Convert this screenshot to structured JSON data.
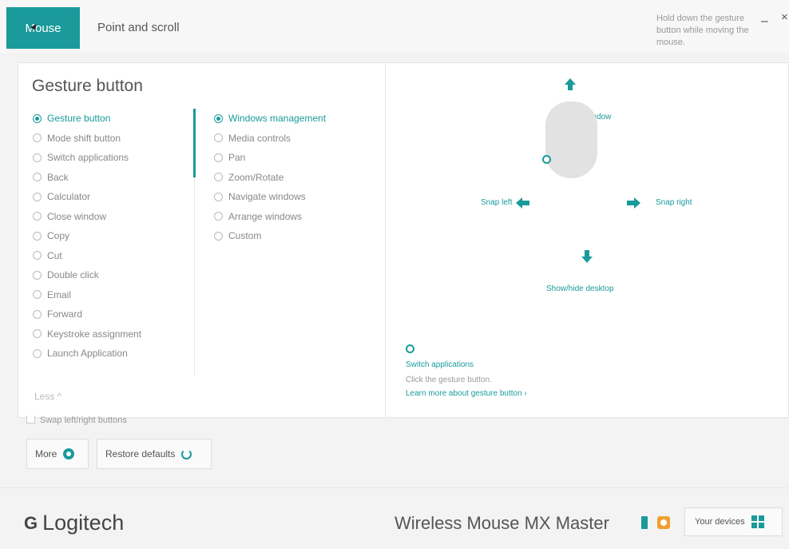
{
  "window": {
    "minimize": "–",
    "close": "×"
  },
  "tabs": {
    "mouse": "Mouse",
    "point_scroll": "Point and scroll"
  },
  "panel": {
    "title": "Gesture button",
    "buttons_list": [
      {
        "label": "Gesture button",
        "selected": true
      },
      {
        "label": "Mode shift button",
        "selected": false
      },
      {
        "label": "Switch applications",
        "selected": false
      },
      {
        "label": "Back",
        "selected": false
      },
      {
        "label": "Calculator",
        "selected": false
      },
      {
        "label": "Close window",
        "selected": false
      },
      {
        "label": "Copy",
        "selected": false
      },
      {
        "label": "Cut",
        "selected": false
      },
      {
        "label": "Double click",
        "selected": false
      },
      {
        "label": "Email",
        "selected": false
      },
      {
        "label": "Forward",
        "selected": false
      },
      {
        "label": "Keystroke assignment",
        "selected": false
      },
      {
        "label": "Launch Application",
        "selected": false
      }
    ],
    "gesture_list": [
      {
        "label": "Windows management",
        "selected": true
      },
      {
        "label": "Media controls",
        "selected": false
      },
      {
        "label": "Pan",
        "selected": false
      },
      {
        "label": "Zoom/Rotate",
        "selected": false
      },
      {
        "label": "Navigate windows",
        "selected": false
      },
      {
        "label": "Arrange windows",
        "selected": false
      },
      {
        "label": "Custom",
        "selected": false
      }
    ],
    "less_label": "Less ^"
  },
  "diagram": {
    "hint": "Hold down the gesture button while moving the mouse.",
    "up": "Maximize window",
    "left": "Snap left",
    "right": "Snap right",
    "down": "Show/hide desktop",
    "switch_title": "Switch applications",
    "switch_desc": "Click the gesture button.",
    "learn_more": "Learn more about gesture button ›"
  },
  "bottom_controls": {
    "swap_label": "Swap left/right buttons",
    "more": "More",
    "restore": "Restore defaults"
  },
  "footer": {
    "logo_text": "Logitech",
    "device": "Wireless Mouse MX Master",
    "your_devices": "Your devices"
  },
  "colors": {
    "accent": "#1a9a9b",
    "unifying": "#f0a030"
  }
}
